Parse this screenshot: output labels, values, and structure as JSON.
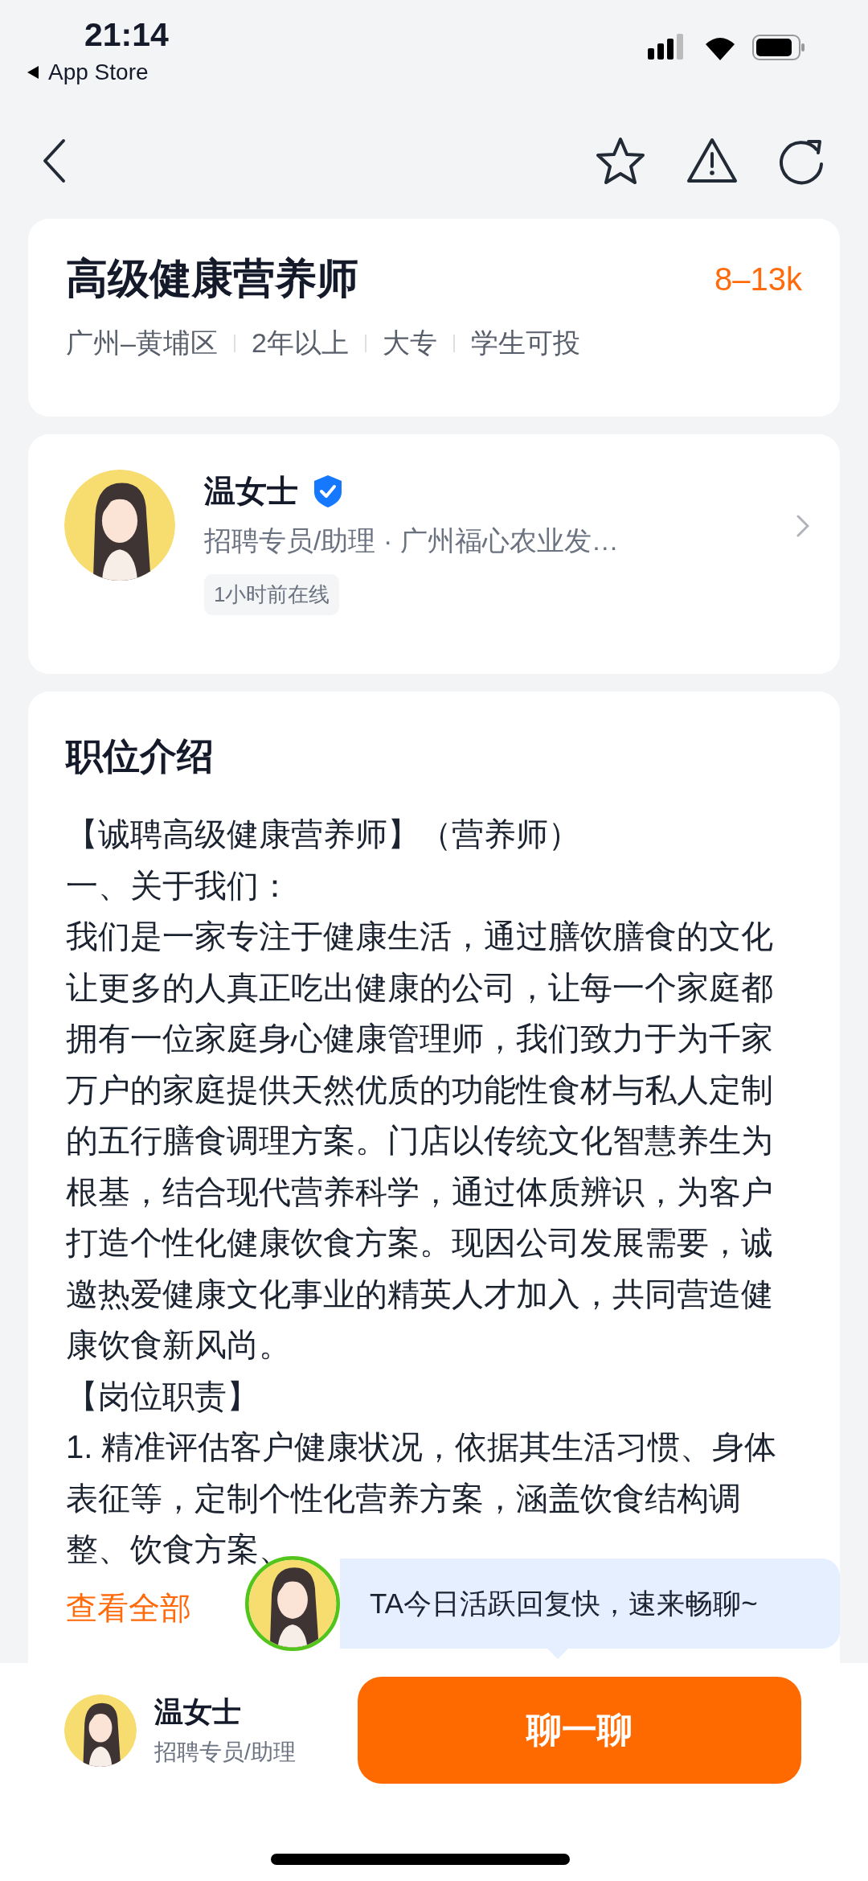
{
  "status_bar": {
    "time": "21:14",
    "back_app": "App Store"
  },
  "job": {
    "title": "高级健康营养师",
    "salary": "8–13k",
    "tags": [
      "广州–黄埔区",
      "2年以上",
      "大专",
      "学生可投"
    ]
  },
  "recruiter": {
    "name": "温女士",
    "verified": true,
    "subtitle": "招聘专员/助理 · 广州福心农业发…",
    "online": "1小时前在线"
  },
  "description": {
    "heading": "职位介绍",
    "paragraphs": [
      "【诚聘高级健康营养师】（营养师）",
      "一、关于我们：",
      "我们是一家专注于健康生活，通过膳饮膳食的文化让更多的人真正吃出健康的公司，让每一个家庭都拥有一位家庭身心健康管理师，我们致力于为千家万户的家庭提供天然优质的功能性食材与私人定制的五行膳食调理方案。门店以传统文化智慧养生为根基，结合现代营养科学，通过体质辨识，为客户打造个性化健康饮食方案。现因公司发展需要，诚邀热爱健康文化事业的精英人才加入，共同营造健康饮食新风尚。",
      "【岗位职责】",
      "1. 精准评估客户健康状况，依据其生活习惯、身体表征等，定制个性化营养方案，涵盖饮食结构调整、饮食方案、"
    ],
    "more_link": "查看全部"
  },
  "bubble": {
    "text": "TA今日活跃回复快，速来畅聊~"
  },
  "bottom_bar": {
    "name": "温女士",
    "role": "招聘专员/助理",
    "button": "聊一聊"
  }
}
